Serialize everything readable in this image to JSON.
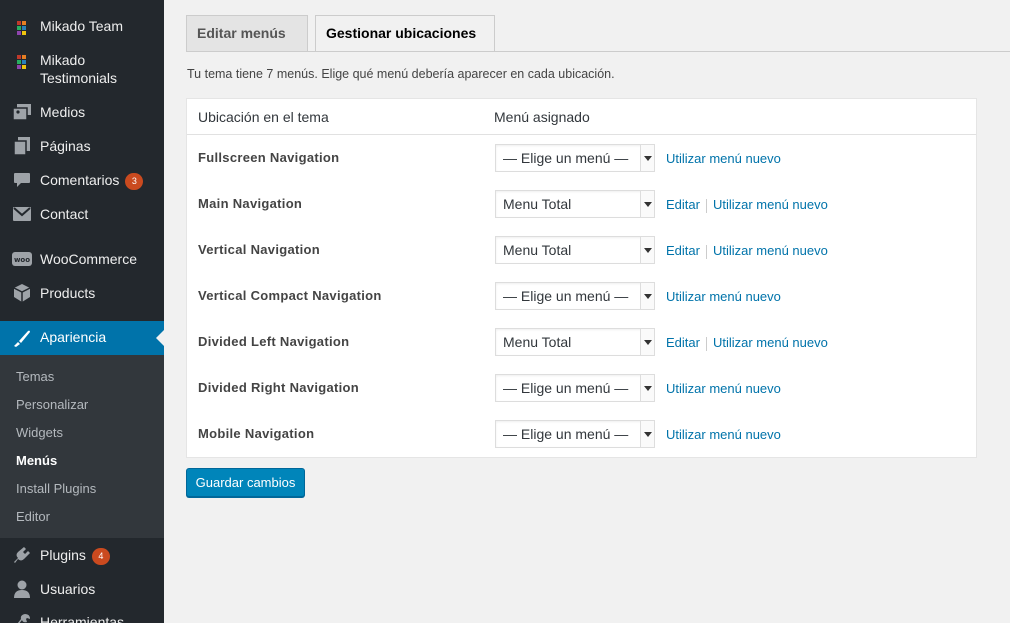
{
  "sidebar": {
    "items": [
      {
        "label": "Mikado Team",
        "icon": "mikado-grid-icon"
      },
      {
        "label": "Mikado Testimonials",
        "icon": "mikado-grid-icon"
      },
      {
        "label": "Medios",
        "icon": "media-icon"
      },
      {
        "label": "Páginas",
        "icon": "pages-icon"
      },
      {
        "label": "Comentarios",
        "icon": "comments-icon",
        "badge": "3"
      },
      {
        "label": "Contact",
        "icon": "mail-icon"
      },
      {
        "label": "WooCommerce",
        "icon": "woocommerce-icon"
      },
      {
        "label": "Products",
        "icon": "products-icon"
      },
      {
        "label": "Apariencia",
        "icon": "paintbrush-icon",
        "active": true
      },
      {
        "label": "Plugins",
        "icon": "plugins-icon",
        "badge": "4"
      },
      {
        "label": "Usuarios",
        "icon": "users-icon"
      },
      {
        "label": "Herramientas",
        "icon": "tools-icon"
      }
    ],
    "submenu": [
      "Temas",
      "Personalizar",
      "Widgets",
      "Menús",
      "Install Plugins",
      "Editor"
    ],
    "submenu_current": "Menús"
  },
  "tabs": [
    {
      "label": "Editar menús",
      "active": false
    },
    {
      "label": "Gestionar ubicaciones",
      "active": true
    }
  ],
  "intro": "Tu tema tiene 7 menús. Elige qué menú debería aparecer en cada ubicación.",
  "table": {
    "headers": [
      "Ubicación en el tema",
      "Menú asignado"
    ],
    "rows": [
      {
        "location": "Fullscreen Navigation",
        "menu": "— Elige un menú —",
        "edit": null,
        "new": "Utilizar menú nuevo"
      },
      {
        "location": "Main Navigation",
        "menu": "Menu Total",
        "edit": "Editar",
        "new": "Utilizar menú nuevo"
      },
      {
        "location": "Vertical Navigation",
        "menu": "Menu Total",
        "edit": "Editar",
        "new": "Utilizar menú nuevo"
      },
      {
        "location": "Vertical Compact Navigation",
        "menu": "— Elige un menú —",
        "edit": null,
        "new": "Utilizar menú nuevo"
      },
      {
        "location": "Divided Left Navigation",
        "menu": "Menu Total",
        "edit": "Editar",
        "new": "Utilizar menú nuevo"
      },
      {
        "location": "Divided Right Navigation",
        "menu": "— Elige un menú —",
        "edit": null,
        "new": "Utilizar menú nuevo"
      },
      {
        "location": "Mobile Navigation",
        "menu": "— Elige un menú —",
        "edit": null,
        "new": "Utilizar menú nuevo"
      }
    ]
  },
  "save_label": "Guardar cambios",
  "colors": {
    "sidebar_bg": "#23282d",
    "active_bg": "#0073aa",
    "link": "#0073aa",
    "badge": "#ca4a1f",
    "button": "#0085ba"
  }
}
